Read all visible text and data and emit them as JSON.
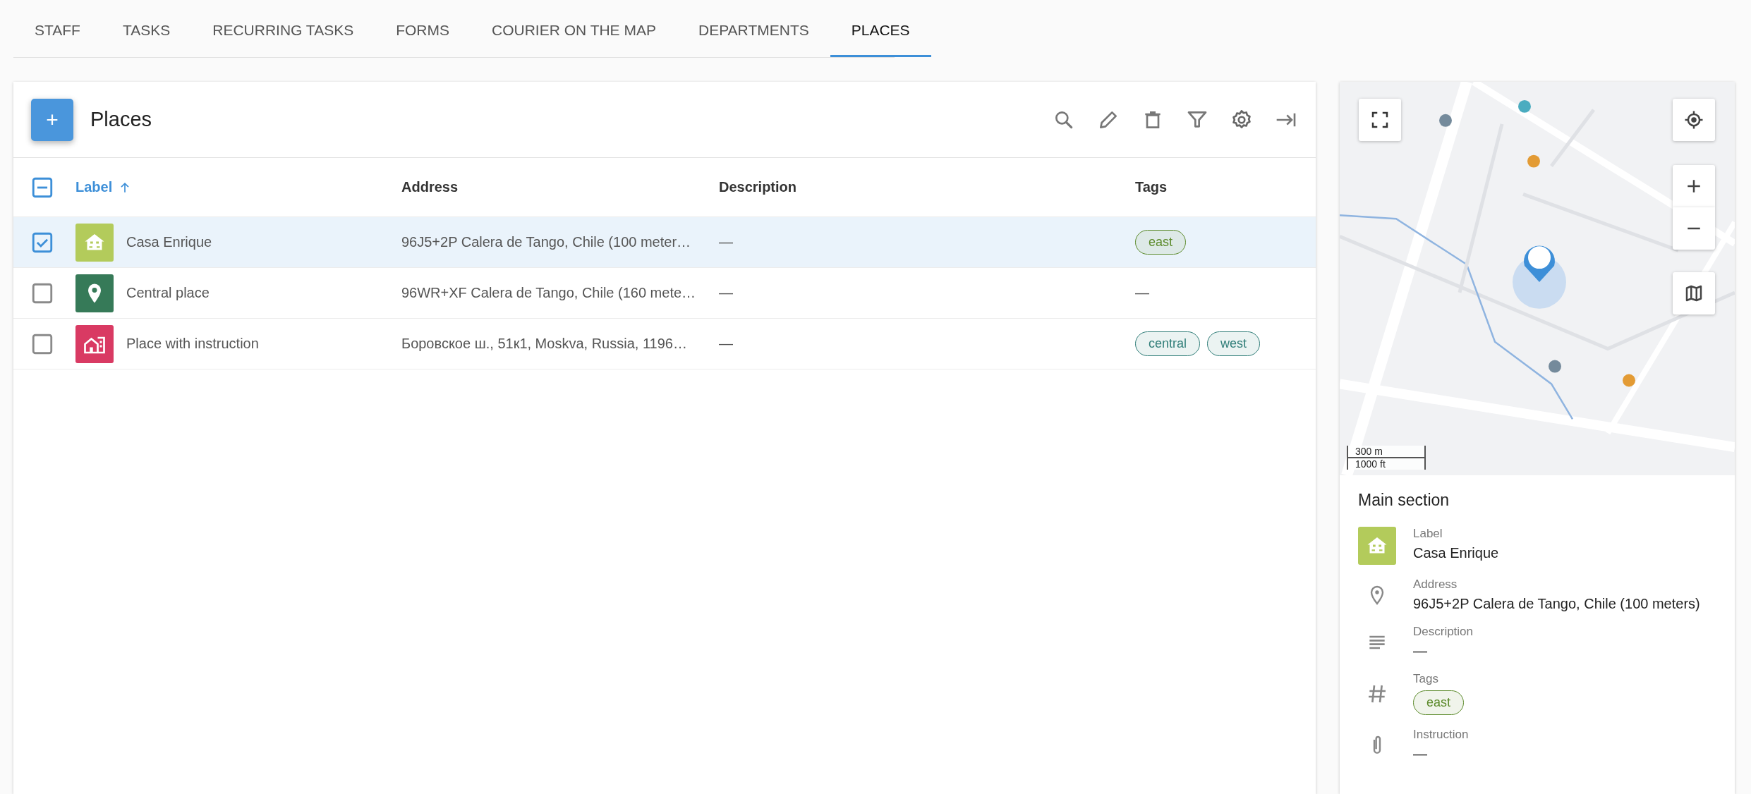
{
  "tabs": [
    {
      "label": "STAFF",
      "selected": false
    },
    {
      "label": "TASKS",
      "selected": false
    },
    {
      "label": "RECURRING TASKS",
      "selected": false
    },
    {
      "label": "FORMS",
      "selected": false
    },
    {
      "label": "COURIER ON THE MAP",
      "selected": false
    },
    {
      "label": "DEPARTMENTS",
      "selected": false
    },
    {
      "label": "PLACES",
      "selected": true
    }
  ],
  "list": {
    "title": "Places",
    "add_button": "+",
    "select_all": {
      "indeterminate": true
    },
    "columns": [
      {
        "label": "Label",
        "sorted": true
      },
      {
        "label": "Address",
        "sorted": false
      },
      {
        "label": "Description",
        "sorted": false
      },
      {
        "label": "Tags",
        "sorted": false
      }
    ],
    "rows": [
      {
        "selected": true,
        "checked": true,
        "kind": "house",
        "color": "#b3cb5b",
        "label": "Casa Enrique",
        "address": "96J5+2P Calera de Tango, Chile (100 meter…",
        "description": "—",
        "tags": [
          {
            "label": "east",
            "color": "#5b8a2a"
          }
        ]
      },
      {
        "selected": false,
        "checked": false,
        "kind": "pin",
        "color": "#367a58",
        "label": "Central place",
        "address": "96WR+XF Calera de Tango, Chile (160 mete…",
        "description": "—",
        "tags_text": "—"
      },
      {
        "selected": false,
        "checked": false,
        "kind": "building",
        "color": "#d93a63",
        "label": "Place with instruction",
        "address": "Боровское ш., 51к1, Moskva, Russia, 1196…",
        "description": "—",
        "tags": [
          {
            "label": "central",
            "color": "#2f7d78"
          },
          {
            "label": "west",
            "color": "#2f7d78"
          }
        ]
      }
    ]
  },
  "map": {
    "kind": "picture",
    "scale": [
      "300 m",
      "1000 ft"
    ]
  },
  "details": {
    "title": "Main section",
    "fields": [
      {
        "kind": "place",
        "color": "#b3cb5b",
        "label": "Label",
        "value": "Casa Enrique"
      },
      {
        "kind": "address",
        "label": "Address",
        "value": "96J5+2P Calera de Tango, Chile (100 meters)"
      },
      {
        "kind": "description",
        "label": "Description",
        "value": "—"
      },
      {
        "kind": "tags",
        "label": "Tags",
        "tags": [
          {
            "label": "east",
            "color": "#5b8a2a"
          }
        ]
      },
      {
        "kind": "instruction",
        "label": "Instruction",
        "value": "—"
      }
    ]
  }
}
